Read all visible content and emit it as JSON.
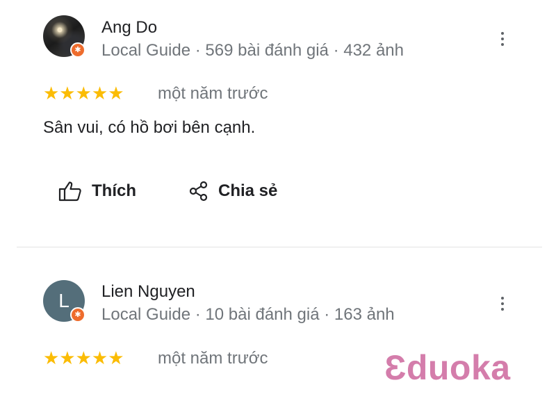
{
  "reviews": [
    {
      "reviewer_name": "Ang Do",
      "reviewer_meta": "Local Guide · 569 bài đánh giá · 432 ảnh",
      "rating": 5,
      "stars": "★★★★★",
      "time_ago": "một năm trước",
      "text": "Sân vui, có hồ bơi bên cạnh.",
      "avatar_type": "photo",
      "actions": {
        "like_label": "Thích",
        "share_label": "Chia sẻ"
      }
    },
    {
      "reviewer_name": "Lien Nguyen",
      "reviewer_meta": "Local Guide · 10 bài đánh giá · 163 ảnh",
      "rating": 5,
      "stars": "★★★★★",
      "time_ago": "một năm trước",
      "avatar_type": "letter",
      "avatar_letter": "L",
      "avatar_color": "#546e7a"
    }
  ],
  "badge_glyph": "✱",
  "watermark": "Ɛduoka",
  "colors": {
    "star": "#fbbc04",
    "guide_badge": "#ee6c2d",
    "watermark": "#d47dab",
    "secondary_text": "#70757a"
  },
  "icons": {
    "more": "more-vert-icon",
    "like": "thumb-up-outline-icon",
    "share": "share-icon",
    "guide_badge": "local-guide-badge-icon"
  }
}
